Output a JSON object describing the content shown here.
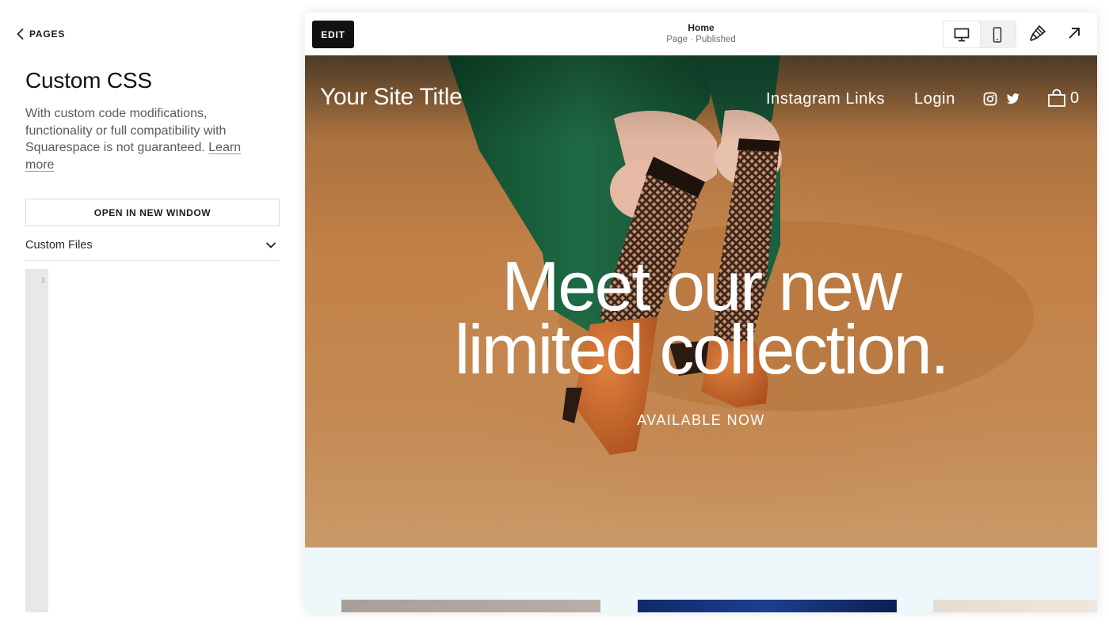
{
  "sidebar": {
    "back_label": "PAGES",
    "title": "Custom CSS",
    "description": "With custom code modifications, functionality or full compatibility with Squarespace is not guaranteed.",
    "learn_more": "Learn more",
    "open_button": "OPEN IN NEW WINDOW",
    "files_label": "Custom Files",
    "editor": {
      "line_number": "1"
    }
  },
  "preview": {
    "edit_label": "EDIT",
    "page_name": "Home",
    "page_status": "Page · Published",
    "device_modes": [
      "desktop-icon",
      "mobile-icon"
    ],
    "active_device": "desktop",
    "tools": [
      "paintbrush-icon",
      "external-link-icon"
    ]
  },
  "site": {
    "title": "Your Site Title",
    "nav": [
      "Instagram Links",
      "Login"
    ],
    "social": [
      "instagram-icon",
      "twitter-icon"
    ],
    "cart_count": "0",
    "headline_line1": "Meet our new",
    "headline_line2": "limited collection.",
    "subheading": "AVAILABLE NOW"
  },
  "colors": {
    "edit_button": "#111111",
    "hero_background": "#c28046",
    "dress": "#1f5a3c",
    "shoes": "#c8652a",
    "lower_section": "#eef7f9"
  }
}
